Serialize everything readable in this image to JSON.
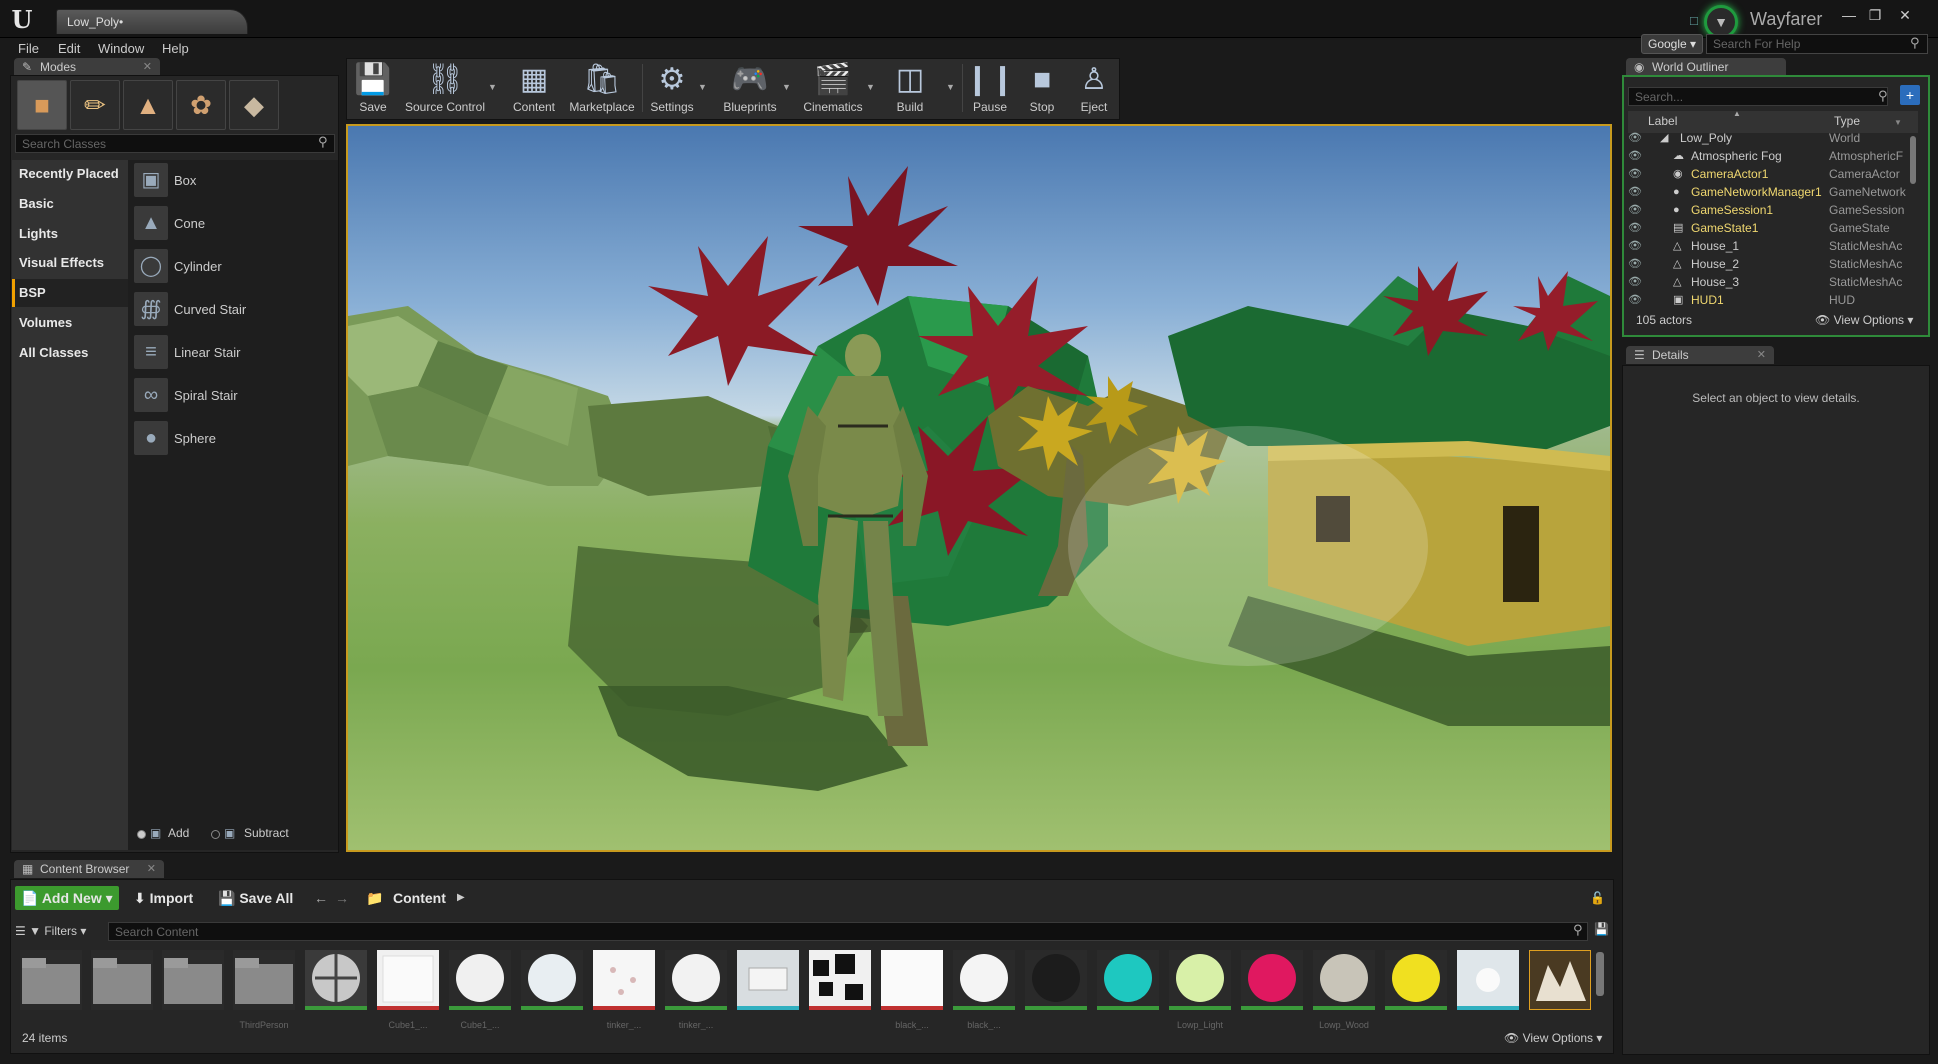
{
  "title_bar": {
    "logo": "U",
    "tab_label": "Low_Poly",
    "tab_modified_mark": "•",
    "project_name": "Wayfarer",
    "minimize": "—",
    "maximize": "❐",
    "close": "✕"
  },
  "menu": {
    "items": [
      "File",
      "Edit",
      "Window",
      "Help"
    ],
    "search_engine": "Google",
    "help_search_placeholder": "Search For Help"
  },
  "modes": {
    "tab_label": "Modes",
    "search_placeholder": "Search Classes",
    "categories": [
      "Recently Placed",
      "Basic",
      "Lights",
      "Visual Effects",
      "BSP",
      "Volumes",
      "All Classes"
    ],
    "active_category": "BSP",
    "classes": [
      "Box",
      "Cone",
      "Cylinder",
      "Curved Stair",
      "Linear Stair",
      "Spiral Stair",
      "Sphere"
    ],
    "brush_add": "Add",
    "brush_subtract": "Subtract"
  },
  "toolbar": {
    "save": "Save",
    "source_control": "Source Control",
    "content": "Content",
    "marketplace": "Marketplace",
    "settings": "Settings",
    "blueprints": "Blueprints",
    "cinematics": "Cinematics",
    "build": "Build",
    "pause": "Pause",
    "stop": "Stop",
    "eject": "Eject"
  },
  "outliner": {
    "tab_label": "World Outliner",
    "search_placeholder": "Search...",
    "col_label": "Label",
    "col_type": "Type",
    "rows": [
      {
        "label": "Low_Poly",
        "type": "World"
      },
      {
        "label": "Atmospheric Fog",
        "type": "AtmosphericF"
      },
      {
        "label": "CameraActor1",
        "type": "CameraActor"
      },
      {
        "label": "GameNetworkManager1",
        "type": "GameNetwork"
      },
      {
        "label": "GameSession1",
        "type": "GameSession"
      },
      {
        "label": "GameState1",
        "type": "GameState"
      },
      {
        "label": "House_1",
        "type": "StaticMeshAc"
      },
      {
        "label": "House_2",
        "type": "StaticMeshAc"
      },
      {
        "label": "House_3",
        "type": "StaticMeshAc"
      },
      {
        "label": "HUD1",
        "type": "HUD"
      }
    ],
    "actor_count": "105 actors",
    "view_options": "View Options"
  },
  "details": {
    "tab_label": "Details",
    "empty_message": "Select an object to view details."
  },
  "content_browser": {
    "tab_label": "Content Browser",
    "add_new": "Add New",
    "import": "Import",
    "save_all": "Save All",
    "path_root": "Content",
    "filters": "Filters",
    "search_placeholder": "Search Content",
    "item_count": "24 items",
    "view_options": "View Options",
    "partial_labels": [
      "ThirdPerson",
      "Cube1_...",
      "Cube1_...",
      "tinker_...",
      "tinker_...",
      "black_...",
      "black_...",
      "Lowp_Light",
      "Lowp_Wood"
    ]
  },
  "colors": {
    "accent_orange": "#f0a000",
    "add_new_green": "#3c9a2e",
    "viewport_border": "#c79a1e",
    "outliner_border": "#2f8a3a",
    "outliner_highlight": "#f0d870"
  }
}
